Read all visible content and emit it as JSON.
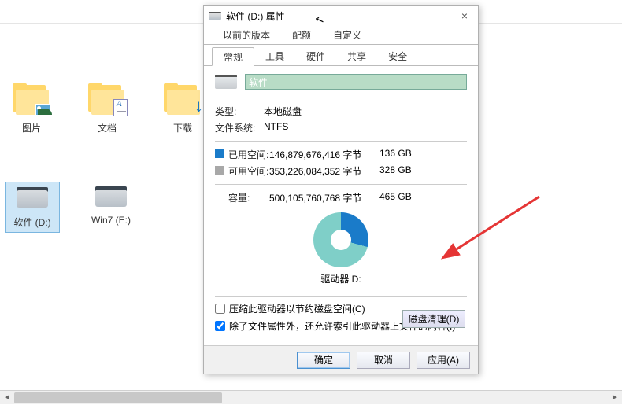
{
  "explorer": {
    "dropdown": "∨",
    "folders": [
      {
        "label": "图片"
      },
      {
        "label": "文档"
      },
      {
        "label": "下载"
      }
    ],
    "drives": [
      {
        "label": "软件 (D:)",
        "selected": true
      },
      {
        "label": "Win7 (E:)",
        "selected": false
      }
    ]
  },
  "dialog": {
    "title": "软件 (D:) 属性",
    "close": "×",
    "tabs_row1": [
      "以前的版本",
      "配额",
      "自定义"
    ],
    "tabs_row2": [
      "常规",
      "工具",
      "硬件",
      "共享",
      "安全"
    ],
    "active_tab": "常规",
    "drive_name": "软件",
    "type_label": "类型:",
    "type_value": "本地磁盘",
    "fs_label": "文件系统:",
    "fs_value": "NTFS",
    "used_label": "已用空间:",
    "used_bytes": "146,879,676,416 字节",
    "used_gb": "136 GB",
    "free_label": "可用空间:",
    "free_bytes": "353,226,084,352 字节",
    "free_gb": "328 GB",
    "capacity_label": "容量:",
    "capacity_bytes": "500,105,760,768 字节",
    "capacity_gb": "465 GB",
    "drive_label": "驱动器 D:",
    "cleanup_btn": "磁盘清理(D)",
    "compress_label": "压缩此驱动器以节约磁盘空间(C)",
    "index_label": "除了文件属性外，还允许索引此驱动器上文件的内容(I)",
    "ok": "确定",
    "cancel": "取消",
    "apply": "应用(A)"
  },
  "chart_data": {
    "type": "pie",
    "title": "驱动器 D:",
    "categories": [
      "已用空间",
      "可用空间"
    ],
    "values": [
      136,
      328
    ],
    "unit": "GB",
    "colors": [
      "#1a7bc9",
      "#7fcfc8"
    ]
  }
}
